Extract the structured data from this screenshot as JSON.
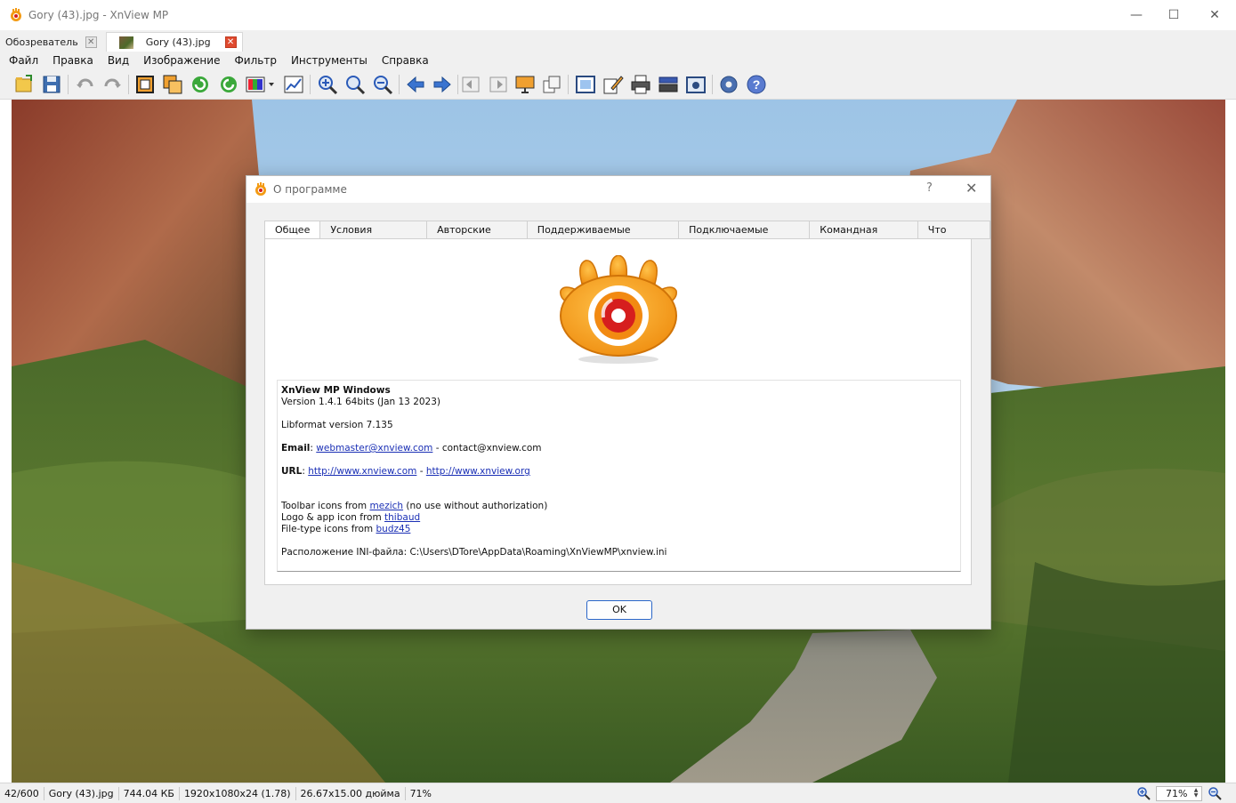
{
  "window": {
    "title": "Gory (43).jpg - XnView MP",
    "minimize": "—",
    "maximize": "☐",
    "close": "✕"
  },
  "tabs": [
    {
      "label": "Обозреватель",
      "close": "✕"
    },
    {
      "label": "Gory (43).jpg",
      "close": "✕"
    }
  ],
  "menu": [
    "Файл",
    "Правка",
    "Вид",
    "Изображение",
    "Фильтр",
    "Инструменты",
    "Справка"
  ],
  "toolbar": {
    "icons": [
      "open-folder-icon",
      "save-icon",
      "undo-icon",
      "redo-icon",
      "crop-icon",
      "resize-icon",
      "rotate-left-icon",
      "rotate-right-icon",
      "color-palette-icon",
      "levels-icon",
      "zoom-in-icon",
      "zoom-fit-icon",
      "zoom-out-icon",
      "arrow-left-icon",
      "arrow-right-icon",
      "first-page-icon",
      "last-page-icon",
      "slideshow-icon",
      "copy-icon",
      "fullscreen-icon",
      "edit-icon",
      "print-icon",
      "scanner-icon",
      "capture-icon",
      "settings-icon",
      "help-icon"
    ]
  },
  "status": {
    "index": "42/600",
    "filename": "Gory (43).jpg",
    "filesize": "744.04 КБ",
    "dimensions": "1920x1080x24 (1.78)",
    "print_size": "26.67x15.00 дюйма",
    "zoom_percent": "71%",
    "zoom_field": "71%"
  },
  "dialog": {
    "title": "О программе",
    "help": "?",
    "close": "✕",
    "tabs": [
      "Общее",
      "Условия лицензии",
      "Авторские права",
      "Поддерживаемые форматы",
      "Подключаемые модули",
      "Командная строка",
      "Что нового"
    ],
    "info": {
      "product": "XnView MP Windows",
      "version": "Version 1.4.1 64bits (Jan 13 2023)",
      "libformat": "Libformat version 7.135",
      "email_label": "Email",
      "email_link": "webmaster@xnview.com",
      "email_other": "contact@xnview.com",
      "url_label": "URL",
      "url_link1": "http://www.xnview.com",
      "url_link2": "http://www.xnview.org",
      "toolbar_icons_prefix": "Toolbar icons from ",
      "toolbar_icons_link": "mezich",
      "toolbar_icons_suffix": " (no use without authorization)",
      "logo_prefix": "Logo & app icon from ",
      "logo_link": "thibaud",
      "filetype_prefix": "File-type icons from ",
      "filetype_link": "budz45",
      "ini_label": "Расположение INI-файла: C:\\Users\\DTore\\AppData\\Roaming\\XnViewMP\\xnview.ini"
    },
    "ok": "OK"
  },
  "colors": {
    "logo_orange": "#f39a12",
    "logo_red": "#d61e1e",
    "link_blue": "#1a2fb5",
    "ok_border": "#2a66c8",
    "tab_close_red": "#e04a2f"
  }
}
